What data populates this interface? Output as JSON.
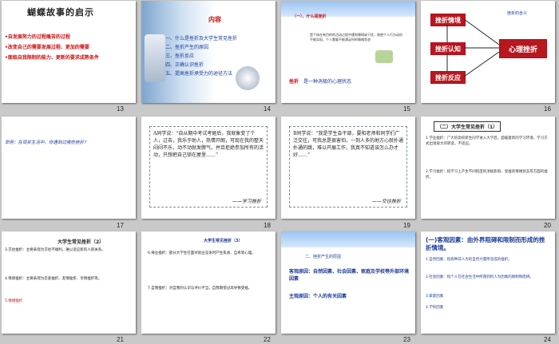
{
  "slides": [
    {
      "num": "13",
      "title": "蝴蝶故事的启示",
      "lines": [
        "•自发展努力的过程痛苦的过程",
        "•改变自己的需要发展过程、更加的需要",
        "•面临自我限制的能力、更新的要求成熟条件"
      ]
    },
    {
      "num": "14",
      "title": "内容",
      "items": [
        "一、什么是挫折及大学生常见挫折",
        "二、挫折产生的原因",
        "三、挫折反应",
        "四、正确认识挫折",
        "五、提高挫折承受力的途径方法"
      ]
    },
    {
      "num": "15",
      "title": "（一）、什么是挫折",
      "body": "是个体在有目的的活动过程中遇到障碍或干扰，致使个人行为动机不能实现，个人需要不能满足时的情绪状态",
      "footer_label": "挫折",
      "footer_text": "是一种消极的心理状态"
    },
    {
      "num": "16",
      "title": "挫折的含义",
      "boxes": [
        "挫折情境",
        "挫折认知",
        "挫折反应"
      ],
      "center": "心理挫折"
    },
    {
      "num": "17",
      "text": "举例：在现实生活中，你遇到过哪些挫折？"
    },
    {
      "num": "18",
      "quote": "A同学说：“自从期中考试考砸后，我就象变了个人，过去，我乐于助人，热情开朗，可现在我的整天闷闷不乐，动不动就发脾气，并且拒绝参加所有的活动，只想把自己锁在屋里……”",
      "caption": "——学习挫折"
    },
    {
      "num": "19",
      "quote": "B同学说：“我是学生会干部，要和老师和同学们广泛交往，可我总是很害怕，一到人多的地方心就扑通扑通的跳，难以开展工作，我真不知道该怎么办才好……”",
      "caption": "——交往挫折"
    },
    {
      "num": "20",
      "title": "（二）大学生常见挫折（1）",
      "lines": [
        "1.学业挫折：广大的高校新生同学进入大学后，面临着新的学习环境，学习方式出现很大的转变，不适应。",
        "2.学习挫折：指学习上产生不同程度的消极影响、受挫的情绪状态等方面的挫折。"
      ]
    },
    {
      "num": "21",
      "title": "大学生常见挫折（2）",
      "lines": [
        "3.交往挫折：主要表现为交往不顺利，难以适应新的人际关系。",
        "4.情感挫折：主要表现为恋爱挫折、友情挫折、亲情挫折等。",
        "5.情绪挫折"
      ]
    },
    {
      "num": "22",
      "title": "大学生常见挫折（3）",
      "lines": [
        "6.择业挫折：部分大学生在面对就业竞争时产生焦虑、自卑等心理。",
        "7.自我挫折：对自我的认识与评价不当，自我期望过高导致受挫。"
      ]
    },
    {
      "num": "23",
      "title": "二、挫折产生的原因",
      "items": [
        "客观原因：自然因素、社会因素、家庭及学校等外部环境因素",
        "主观原因：个人的有关因素"
      ]
    },
    {
      "num": "24",
      "title": "(一)客观因素：由外界阻碍和限制而形成的挫折情境。",
      "lines": [
        "1.自然因素：指各种非人为的自然力量所造成的挫折。",
        "2.社会因素：指个人在社会生活中所遇到的人为因素的限制和阻碍。",
        "3.家庭因素",
        "4.学校因素"
      ]
    }
  ]
}
